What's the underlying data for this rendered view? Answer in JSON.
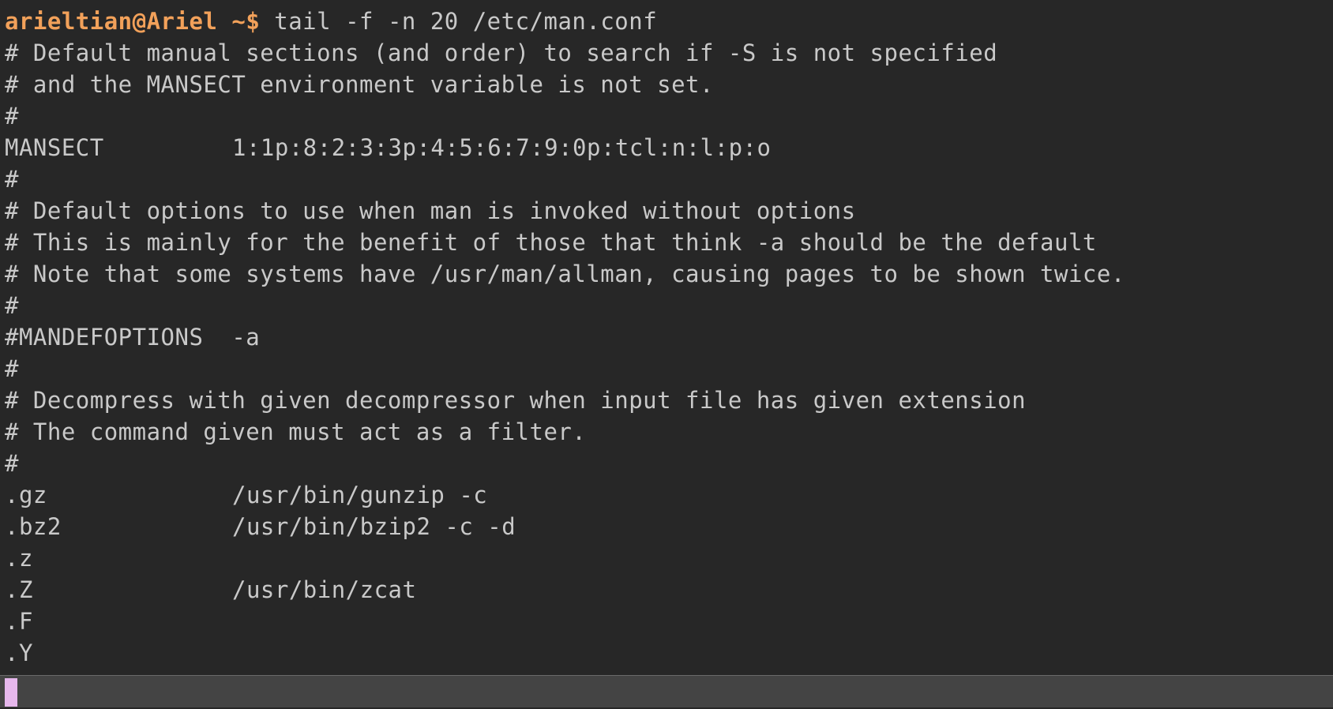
{
  "prompt": {
    "user_host": "arieltian@Ariel",
    "dir": "~$",
    "command": "tail -f -n 20 /etc/man.conf"
  },
  "output_lines": [
    {
      "text": "# Default manual sections (and order) to search if -S is not specified"
    },
    {
      "text": "# and the MANSECT environment variable is not set."
    },
    {
      "text": "#"
    },
    {
      "key": "MANSECT",
      "value": "1:1p:8:2:3:3p:4:5:6:7:9:0p:tcl:n:l:p:o"
    },
    {
      "text": "#"
    },
    {
      "text": "# Default options to use when man is invoked without options"
    },
    {
      "text": "# This is mainly for the benefit of those that think -a should be the default"
    },
    {
      "text": "# Note that some systems have /usr/man/allman, causing pages to be shown twice."
    },
    {
      "text": "#"
    },
    {
      "text": "#MANDEFOPTIONS  -a"
    },
    {
      "text": "#"
    },
    {
      "text": "# Decompress with given decompressor when input file has given extension"
    },
    {
      "text": "# The command given must act as a filter."
    },
    {
      "text": "#"
    },
    {
      "key": ".gz",
      "value": "/usr/bin/gunzip -c"
    },
    {
      "key": ".bz2",
      "value": "/usr/bin/bzip2 -c -d"
    },
    {
      "key": ".z",
      "value": ""
    },
    {
      "key": ".Z",
      "value": "/usr/bin/zcat"
    },
    {
      "key": ".F",
      "value": ""
    },
    {
      "key": ".Y",
      "value": ""
    }
  ],
  "colors": {
    "background": "#272727",
    "text": "#c9c9c9",
    "prompt": "#f2a15a",
    "input_bar": "#444444",
    "cursor": "#e6b7ec"
  }
}
